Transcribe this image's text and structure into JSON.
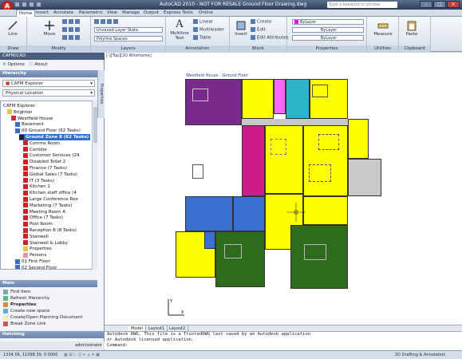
{
  "title_bar": {
    "app_title": "AutoCAD 2010 - NOT FOR RESALE    Ground Floor Drawing.dwg",
    "search_placeholder": "Type a keyword or phrase"
  },
  "ribbon_tabs": [
    "Home",
    "Insert",
    "Annotate",
    "Parametric",
    "View",
    "Manage",
    "Output",
    "Express Tools",
    "Online"
  ],
  "ribbon": {
    "draw": {
      "label": "Draw",
      "line": "Line"
    },
    "modify": {
      "label": "Modify",
      "move": "Move"
    },
    "layers": {
      "label": "Layers",
      "state": "Unsaved Layer State",
      "current": "Polyline Spaces"
    },
    "annotation": {
      "label": "Annotation",
      "mtext": "Multiline Text",
      "linear": "Linear",
      "multileader": "Multileader",
      "table": "Table"
    },
    "block": {
      "label": "Block",
      "insert": "Insert",
      "create": "Create",
      "edit": "Edit",
      "edit_attributes": "Edit Attributes"
    },
    "properties": {
      "label": "Properties",
      "color": "ByLayer",
      "linetype": "ByLayer",
      "lineweight": "ByLayer"
    },
    "utilities": {
      "label": "Utilities",
      "measure": "Measure"
    },
    "clipboard": {
      "label": "Clipboard",
      "paste": "Paste"
    }
  },
  "left_panel": {
    "title": "CAFM/CAD",
    "options": "Options",
    "about": "About",
    "hierarchy_header": "Hierarchy",
    "explorer_select": "CAFM Explorer",
    "location_select": "Physical Location",
    "vertical_tab": "Properties",
    "tree": [
      {
        "label": "CAFM Explorer",
        "level": 0,
        "icon": "none"
      },
      {
        "label": "Brighton",
        "level": 1,
        "icon": "folder"
      },
      {
        "label": "Westfield House",
        "level": 2,
        "icon": "building"
      },
      {
        "label": "Basement",
        "level": 3,
        "icon": "floor"
      },
      {
        "label": "00 Ground Floor (62 Tasks)",
        "level": 3,
        "icon": "floor"
      },
      {
        "label": "Ground Zone 8 (62 Tasks)",
        "level": 4,
        "icon": "zone",
        "selected": true
      },
      {
        "label": "Comms Room",
        "level": 5,
        "icon": "room"
      },
      {
        "label": "Corridor",
        "level": 5,
        "icon": "room"
      },
      {
        "label": "Customer Services (29",
        "level": 5,
        "icon": "room"
      },
      {
        "label": "Disabled Toilet 2",
        "level": 5,
        "icon": "room"
      },
      {
        "label": "Finance (7 Tasks)",
        "level": 5,
        "icon": "room"
      },
      {
        "label": "Global Sales (7 Tasks)",
        "level": 5,
        "icon": "room"
      },
      {
        "label": "IT (3 Tasks)",
        "level": 5,
        "icon": "room"
      },
      {
        "label": "Kitchen 1",
        "level": 5,
        "icon": "room"
      },
      {
        "label": "Kitchen staff office (4",
        "level": 5,
        "icon": "room"
      },
      {
        "label": "Large Conference Roo",
        "level": 5,
        "icon": "room"
      },
      {
        "label": "Marketing (7 Tasks)",
        "level": 5,
        "icon": "room"
      },
      {
        "label": "Meeting Room A",
        "level": 5,
        "icon": "room"
      },
      {
        "label": "Office (7 Tasks)",
        "level": 5,
        "icon": "room"
      },
      {
        "label": "Post Room",
        "level": 5,
        "icon": "room"
      },
      {
        "label": "Reception B (8 Tasks)",
        "level": 5,
        "icon": "room"
      },
      {
        "label": "Stairwell",
        "level": 5,
        "icon": "room"
      },
      {
        "label": "Stairwell & Lobby",
        "level": 5,
        "icon": "room"
      },
      {
        "label": "Properties",
        "level": 5,
        "icon": "props"
      },
      {
        "label": "Persons",
        "level": 5,
        "icon": "persons"
      },
      {
        "label": "01 First Floor",
        "level": 3,
        "icon": "floor"
      },
      {
        "label": "02 Second Floor",
        "level": 3,
        "icon": "floor"
      }
    ],
    "main_header": "Main",
    "tasks": [
      "Find Item",
      "Refresh Hierarchy",
      "Properties",
      "Create new space",
      "Create/Open Planning Document",
      "Break Zone Link"
    ],
    "hatching_header": "Hatching",
    "user": "administrator"
  },
  "drawing": {
    "title": "Westfield House - Ground Floor",
    "colors": {
      "yellow": "#ffff00",
      "magenta": "#cc1c8c",
      "purple": "#7a2a8c",
      "blue": "#3b6fd1",
      "green": "#2f6b1c",
      "cyan": "#2bb5c9",
      "gray": "#c9c9c9",
      "pink": "#f7b6e8"
    }
  },
  "layout_tabs": [
    "Model",
    "Layout1",
    "Layout2"
  ],
  "command_lines": [
    "Autodesk DWG.  This file is a TrustedDWG last saved by an Autodesk application",
    "or Autodesk licensed application.",
    "Command:"
  ],
  "status": {
    "coords": "1334.56, 11398.39, 0.0000",
    "workspace": "2D Drafting & Annotation"
  }
}
